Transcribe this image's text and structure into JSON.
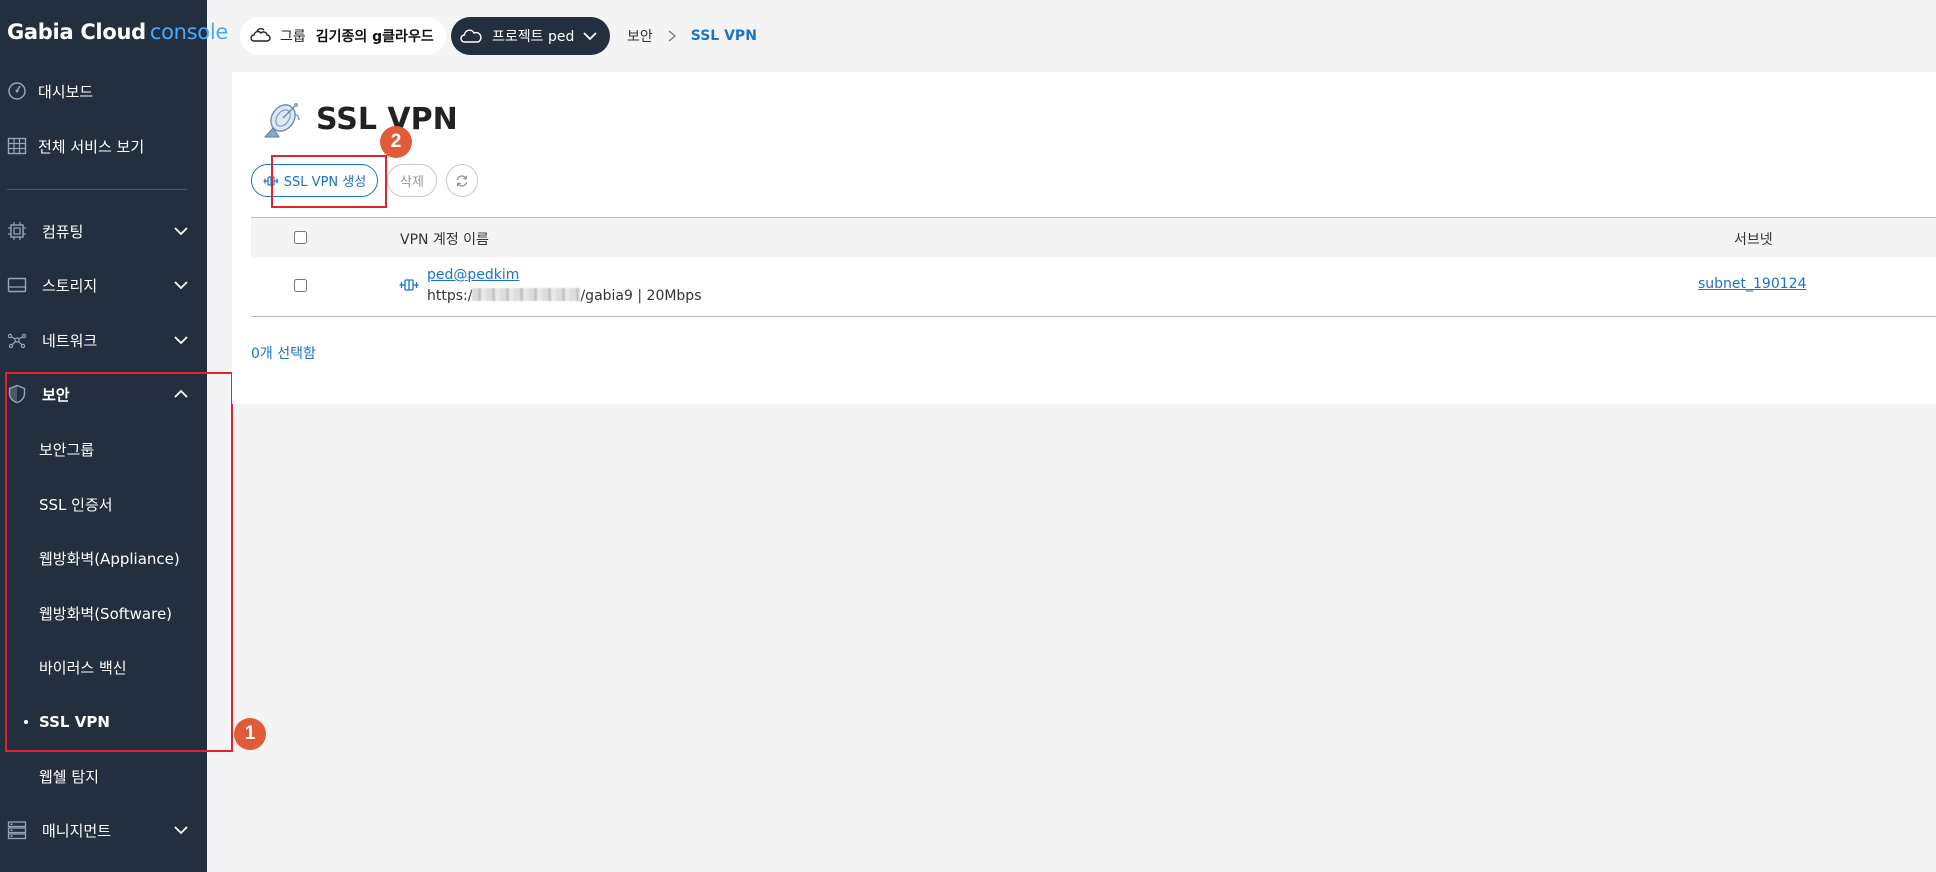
{
  "sidebar": {
    "logo_brand": "Gabia Cloud",
    "logo_console": "console",
    "items": [
      {
        "label": "대시보드",
        "icon": "dashboard-icon"
      },
      {
        "label": "전체 서비스 보기",
        "icon": "grid-icon"
      },
      {
        "label": "컴퓨팅",
        "icon": "cpu-icon"
      },
      {
        "label": "스토리지",
        "icon": "storage-icon"
      },
      {
        "label": "네트워크",
        "icon": "network-icon"
      },
      {
        "label": "보안",
        "icon": "shield-icon"
      },
      {
        "label": "매니지먼트",
        "icon": "management-icon"
      }
    ],
    "security_sub": [
      {
        "label": "보안그룹"
      },
      {
        "label": "SSL 인증서"
      },
      {
        "label": "웹방화벽(Appliance)"
      },
      {
        "label": "웹방화벽(Software)"
      },
      {
        "label": "바이러스 백신"
      },
      {
        "label": "SSL VPN",
        "active": true
      },
      {
        "label": "웹쉘 탐지"
      }
    ]
  },
  "topbar": {
    "group_prefix": "그룹",
    "group_name": "김기종의 g클라우드",
    "project_label": "프로젝트 ped",
    "breadcrumb": [
      "보안",
      "SSL VPN"
    ]
  },
  "page": {
    "title": "SSL VPN",
    "create_button": "SSL VPN 생성",
    "delete_button": "삭제",
    "columns": [
      "VPN 계정 이름",
      "서브넷"
    ],
    "rows": [
      {
        "name": "ped@pedkim",
        "url_prefix": "https:/",
        "url_suffix": "/gabia9 | 20Mbps",
        "subnet": "subnet_190124"
      }
    ],
    "selected_count": "0개 선택함"
  },
  "annotations": {
    "badge1": "1",
    "badge2": "2"
  },
  "colors": {
    "sidebar_bg": "#232f3e",
    "accent": "#1a73c8",
    "annotation_red": "#e0242e",
    "badge_orange": "#e05b3a"
  }
}
